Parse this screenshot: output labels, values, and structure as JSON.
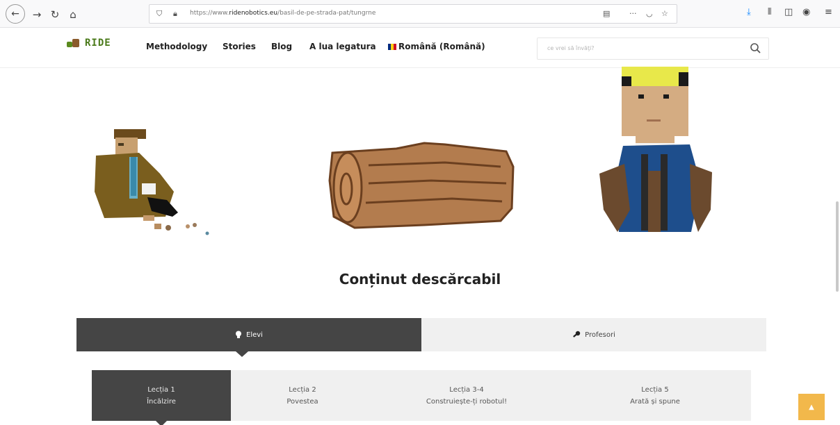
{
  "browser": {
    "url_prefix": "https://www.",
    "url_host": "ridenobotics.eu",
    "url_path": "/basil-de-pe-strada-pat/tungrne"
  },
  "nav": {
    "logo_text": "RIDE",
    "items": [
      "Methodology",
      "Stories",
      "Blog",
      "A lua legatura"
    ],
    "language": "Română (Română)",
    "search_placeholder": "ce vrei să învăţi?"
  },
  "content": {
    "heading": "Conținut descărcabil"
  },
  "tabs": [
    {
      "label": "Elevi",
      "icon": "lightbulb-icon",
      "active": true
    },
    {
      "label": "Profesori",
      "icon": "key-icon",
      "active": false
    }
  ],
  "lessons": [
    {
      "number": "Lecția 1",
      "title": "Încălzire",
      "active": true
    },
    {
      "number": "Lecția 2",
      "title": "Povestea",
      "active": false
    },
    {
      "number": "Lecția 3-4",
      "title": "Construiește-ți robotul!",
      "active": false
    },
    {
      "number": "Lecția 5",
      "title": "Arată și spune",
      "active": false
    }
  ],
  "colors": {
    "tab_active": "#454545",
    "tab_inactive": "#f0f0f0",
    "scroll_top": "#f2b84b",
    "logo_green": "#4a7a1a"
  }
}
